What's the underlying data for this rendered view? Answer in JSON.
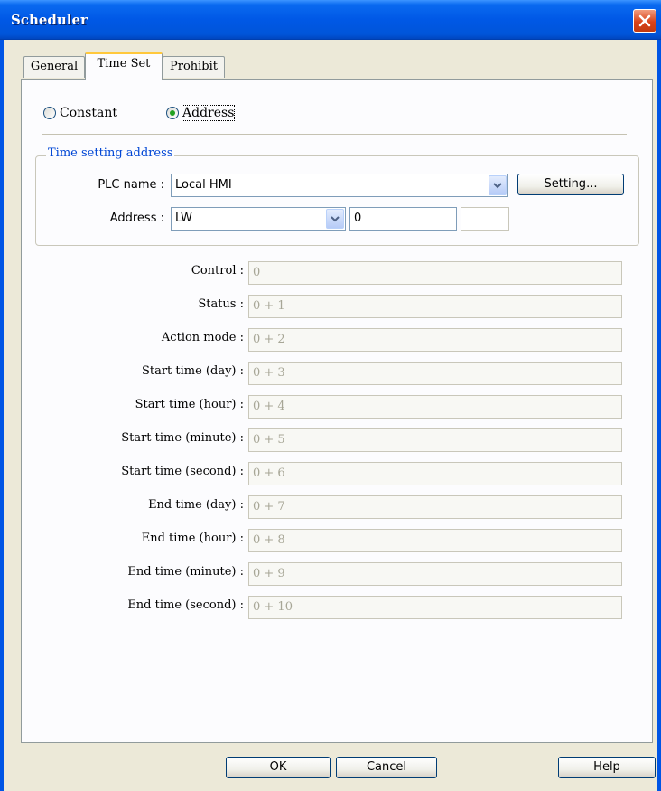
{
  "window": {
    "title": "Scheduler"
  },
  "tabs": [
    {
      "label": "General"
    },
    {
      "label": "Time Set"
    },
    {
      "label": "Prohibit"
    }
  ],
  "mode": {
    "constant_label": "Constant",
    "address_label": "Address",
    "selected": "Address"
  },
  "group": {
    "legend": "Time setting address",
    "plc_label": "PLC name :",
    "plc_value": "Local HMI",
    "setting_label": "Setting...",
    "address_label": "Address :",
    "address_device": "LW",
    "address_value": "0",
    "address_extra": ""
  },
  "fields": [
    {
      "label": "Control :",
      "value": "0"
    },
    {
      "label": "Status :",
      "value": "0 + 1"
    },
    {
      "label": "Action mode :",
      "value": "0 + 2"
    },
    {
      "label": "Start time (day) :",
      "value": "0 + 3"
    },
    {
      "label": "Start time (hour) :",
      "value": "0 + 4"
    },
    {
      "label": "Start time (minute) :",
      "value": "0 + 5"
    },
    {
      "label": "Start time (second) :",
      "value": "0 + 6"
    },
    {
      "label": "End time (day) :",
      "value": "0 + 7"
    },
    {
      "label": "End time (hour) :",
      "value": "0 + 8"
    },
    {
      "label": "End time (minute) :",
      "value": "0 + 9"
    },
    {
      "label": "End time (second) :",
      "value": "0 + 10"
    }
  ],
  "buttons": {
    "ok": "OK",
    "cancel": "Cancel",
    "help": "Help"
  },
  "colors": {
    "titlebar": "#0058E6",
    "legend": "#0046D5",
    "close": "#D9431A",
    "focus_tab": "#FFC83C"
  }
}
